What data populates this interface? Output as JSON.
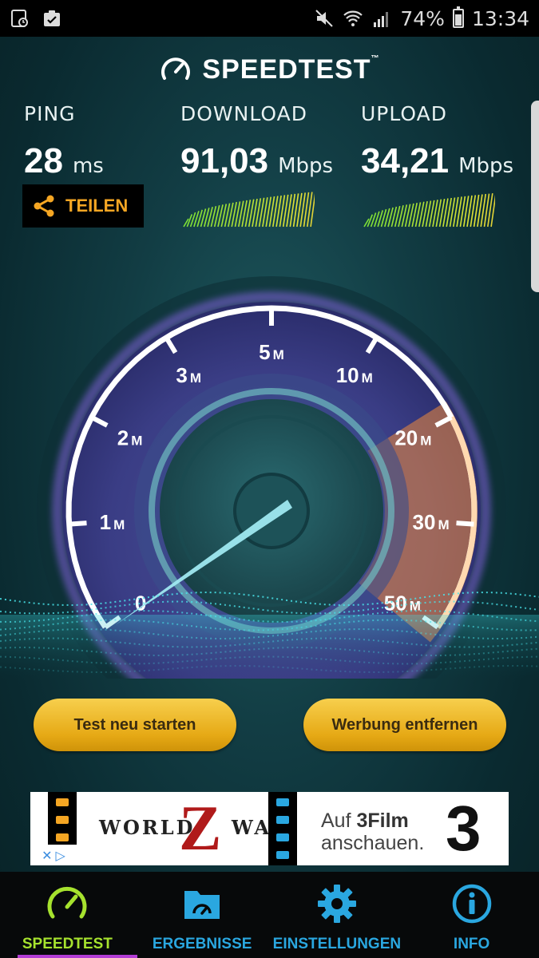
{
  "status_bar": {
    "battery": "74%",
    "time": "13:34",
    "icons": [
      "screenshot-icon",
      "clipboard-icon",
      "mute-icon",
      "wifi-icon",
      "signal-icon",
      "battery-icon"
    ]
  },
  "header": {
    "logo_text": "SPEEDTEST",
    "trademark": "™"
  },
  "metrics": {
    "ping": {
      "label": "PING",
      "value": "28",
      "unit": "ms"
    },
    "download": {
      "label": "DOWNLOAD",
      "value": "91,03",
      "unit": "Mbps"
    },
    "upload": {
      "label": "UPLOAD",
      "value": "34,21",
      "unit": "Mbps"
    }
  },
  "share": {
    "label": "TEILEN"
  },
  "gauge": {
    "ticks": [
      {
        "num": "0",
        "unit": ""
      },
      {
        "num": "1",
        "unit": "M"
      },
      {
        "num": "2",
        "unit": "M"
      },
      {
        "num": "3",
        "unit": "M"
      },
      {
        "num": "5",
        "unit": "M"
      },
      {
        "num": "10",
        "unit": "M"
      },
      {
        "num": "20",
        "unit": "M"
      },
      {
        "num": "30",
        "unit": "M"
      },
      {
        "num": "50",
        "unit": "M"
      }
    ],
    "needle_value": "0",
    "colors": {
      "arc": "#9b6cff",
      "highlight": "#f08a3a"
    }
  },
  "buttons": {
    "restart": "Test neu starten",
    "remove_ads": "Werbung entfernen"
  },
  "ad": {
    "title_left": "WORLD",
    "title_right": "WAR",
    "z_letter": "Z",
    "text_line1_prefix": "Auf ",
    "text_line1_bold": "3Film",
    "text_line2": "anschauen.",
    "brand_logo": "3"
  },
  "nav": {
    "items": [
      {
        "label": "SPEEDTEST",
        "icon": "speedometer-icon",
        "active": true
      },
      {
        "label": "ERGEBNISSE",
        "icon": "results-folder-icon",
        "active": false
      },
      {
        "label": "EINSTELLUNGEN",
        "icon": "gear-icon",
        "active": false
      },
      {
        "label": "INFO",
        "icon": "info-icon",
        "active": false
      }
    ],
    "colors": {
      "active": "#a6e22e",
      "inactive": "#2aa7e0"
    }
  }
}
